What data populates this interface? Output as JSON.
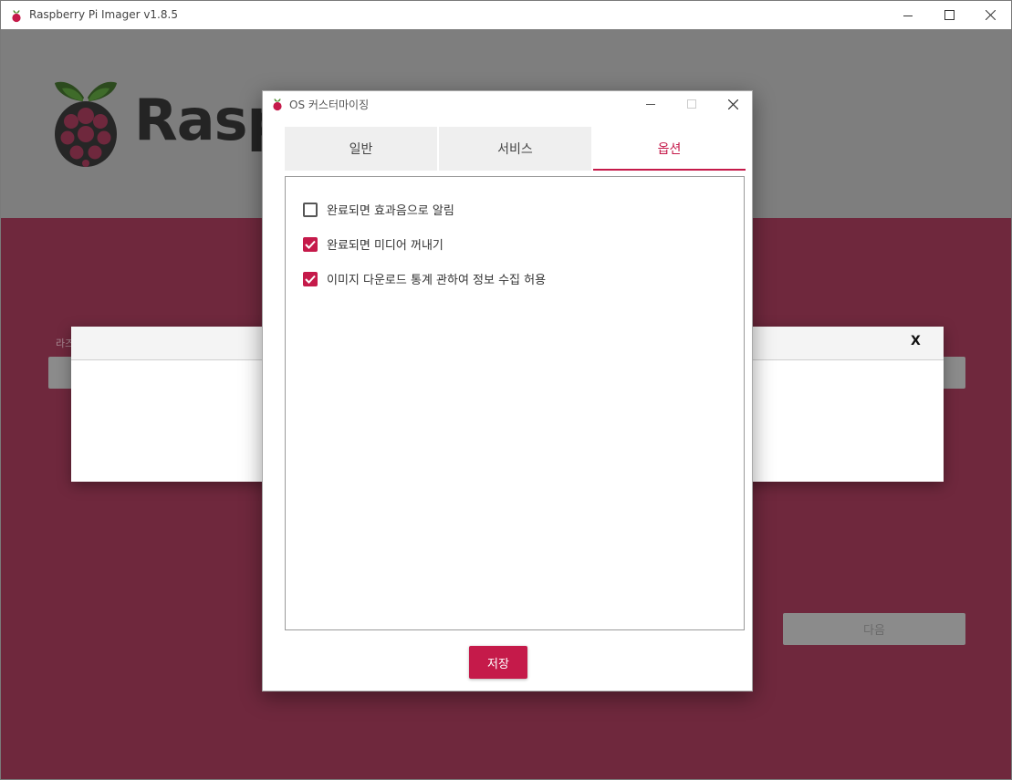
{
  "window": {
    "title": "Raspberry Pi Imager v1.8.5"
  },
  "header": {
    "brand_text": "Rasp"
  },
  "background": {
    "label": "라즈",
    "next_button": "다음",
    "bottom_text": "....."
  },
  "popup": {
    "close_label": "X"
  },
  "dialog": {
    "title": "OS 커스터마이징",
    "tabs": [
      {
        "label": "일반",
        "active": false
      },
      {
        "label": "서비스",
        "active": false
      },
      {
        "label": "옵션",
        "active": true
      }
    ],
    "options": [
      {
        "label": "완료되면 효과음으로 알림",
        "checked": false
      },
      {
        "label": "완료되면 미디어 꺼내기",
        "checked": true
      },
      {
        "label": "이미지 다운로드 통계 관하여 정보 수집 허용",
        "checked": true
      }
    ],
    "save_button": "저장"
  },
  "colors": {
    "accent": "#c51a4a",
    "background_red": "#6f283d",
    "header_gray": "#7e7e7e"
  },
  "icons": [
    "raspberry-icon",
    "minimize-icon",
    "maximize-icon",
    "close-icon",
    "checkbox-checked-icon",
    "checkbox-empty-icon"
  ]
}
